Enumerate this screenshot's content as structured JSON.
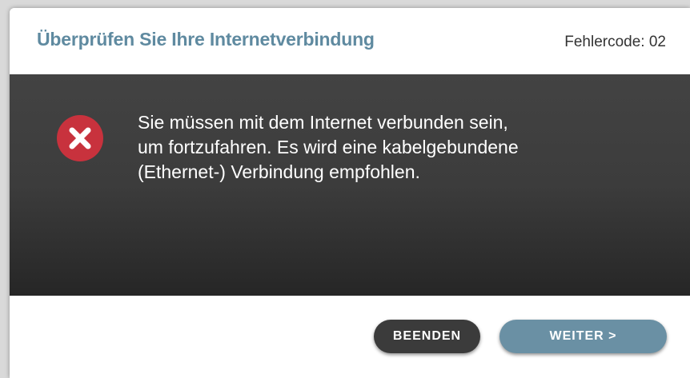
{
  "dialog": {
    "title": "Überprüfen Sie Ihre Internetverbindung",
    "error_code": "Fehlercode: 02",
    "icon": "error-x-icon",
    "message": "Sie müssen mit dem Internet verbunden sein,\num fortzufahren. Es wird eine kabelgebundene\n(Ethernet-) Verbindung empfohlen.",
    "buttons": {
      "quit_label": "BEENDEN",
      "next_label": "WEITER >"
    }
  },
  "colors": {
    "title": "#5f8aa0",
    "error_icon": "#c8323d",
    "quit_button": "#3b3b3b",
    "next_button": "#6a90a4",
    "panel": "#3c3c3c"
  }
}
